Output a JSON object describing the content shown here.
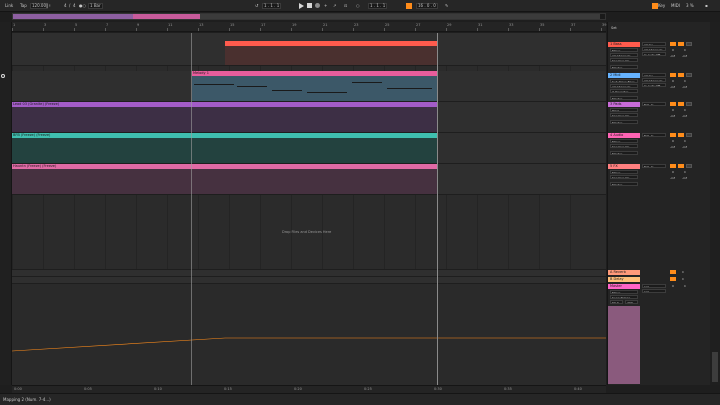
{
  "transport": {
    "link_label": "Link",
    "tap_label": "Tap",
    "tempo": "120.00",
    "signature_num": "4",
    "signature_den": "4",
    "quantize": "1 Bar",
    "position": "1 . 1 . 1",
    "loop_start": "1 . 1 . 1",
    "loop_length": "16 . 0 . 0",
    "key_label": "Key",
    "midi_label": "MIDI",
    "cpu": "3 %"
  },
  "ruler": {
    "bars": [
      "1",
      "3",
      "5",
      "7",
      "9",
      "11",
      "13",
      "15",
      "17",
      "19",
      "21",
      "23",
      "25",
      "27",
      "29",
      "31",
      "33",
      "35",
      "37",
      "39"
    ]
  },
  "bottom_ruler": {
    "times": [
      "0:00",
      "0:05",
      "0:10",
      "0:15",
      "0:20",
      "0:25",
      "0:30",
      "0:35",
      "0:40"
    ]
  },
  "clips": {
    "clip2": "Melody 1",
    "clip3": "Lead 03 (Granite) (Freeze)",
    "clip4": "BFB (Freeze) (Freeze)",
    "clip5": "Hauntn (Freeze) (Freeze)"
  },
  "drop_hint": "Drop Files and Devices Here",
  "mixer": {
    "set_label": "Set",
    "tracks": [
      {
        "name": "1 Bass",
        "color": "#ff5b4d",
        "input": "All Ins",
        "type": "Mixer",
        "route": "All Channels",
        "monitor": "In Auto Off",
        "out": "Speaker On",
        "master": "Master",
        "vol": "0",
        "pan": "C",
        "inf1": "-inf",
        "inf2": "-inf"
      },
      {
        "name": "2 Midi",
        "color": "#66b3ff",
        "input": "All Ins",
        "type": "Sub Drive Bass",
        "route": "All Channels",
        "monitor": "In Auto Off",
        "out": "3 Operator",
        "master": "Master",
        "vol": "0",
        "pan": "C",
        "inf1": "-inf",
        "inf2": "-inf"
      },
      {
        "name": "3 Pads",
        "color": "#c86bd8",
        "input": "Ext. In",
        "type": "Pixel",
        "route": "",
        "monitor": "",
        "out": "Speaker On",
        "master": "Master",
        "vol": "0",
        "pan": "C",
        "inf1": "-inf",
        "inf2": "-inf"
      },
      {
        "name": "4 Audio",
        "color": "#ff64b4",
        "input": "Ext. In",
        "type": "Mixer",
        "route": "",
        "monitor": "",
        "out": "Speaker On",
        "master": "Master",
        "vol": "0",
        "pan": "C",
        "inf1": "-inf",
        "inf2": "-inf"
      },
      {
        "name": "5 FX",
        "color": "#ff7f7f",
        "input": "Ext. In",
        "type": "Mixer",
        "route": "",
        "monitor": "",
        "out": "Speaker On",
        "master": "Master",
        "vol": "0",
        "pan": "C",
        "inf1": "-inf",
        "inf2": "-inf"
      }
    ],
    "returns": [
      {
        "name": "A Reverb",
        "color": "#ff9a7a",
        "vol": "0",
        "pan": "C"
      },
      {
        "name": "B Delay",
        "color": "#ffc07a",
        "vol": "0",
        "pan": "C"
      }
    ],
    "master": {
      "name": "Master",
      "color": "#ff64c8",
      "type": "Mixer",
      "song_tempo": "Song Tempo",
      "tempo_val": "120",
      "min": "60.0",
      "max": "200",
      "ratio1": "1/2",
      "ratio2": "1/2",
      "vol": "0",
      "pan": "C"
    }
  },
  "status": {
    "text": "Mapping 2 (Num. 7-4...)"
  },
  "colors": {
    "accent": "#ff8c1a",
    "bass": "#ff5b4d",
    "melody": "#e85d9c",
    "lead": "#a35cc8",
    "bfb": "#3fbfb0",
    "hauntn": "#e06aa5"
  }
}
